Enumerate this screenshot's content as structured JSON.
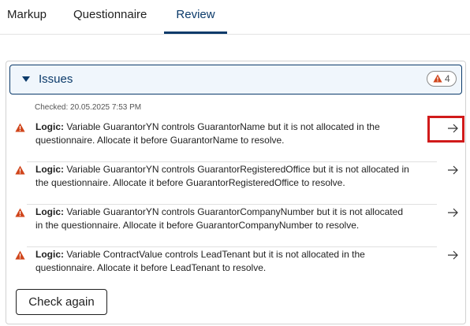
{
  "tabs": {
    "markup": "Markup",
    "questionnaire": "Questionnaire",
    "review": "Review"
  },
  "issues": {
    "title": "Issues",
    "count": "4",
    "checked": "Checked: 20.05.2025 7:53 PM",
    "items": [
      {
        "label": "Logic:",
        "text_line1": " Variable GuarantorYN controls GuarantorName but it is not allocated in the",
        "text_line2": "questionnaire. Allocate it before GuarantorName to resolve."
      },
      {
        "label": "Logic:",
        "text_line1": " Variable GuarantorYN controls GuarantorRegisteredOffice but it is not allocated in",
        "text_line2": "the questionnaire. Allocate it before GuarantorRegisteredOffice to resolve."
      },
      {
        "label": "Logic:",
        "text_line1": " Variable GuarantorYN controls GuarantorCompanyNumber but it is not allocated",
        "text_line2": "in the questionnaire. Allocate it before GuarantorCompanyNumber to resolve."
      },
      {
        "label": "Logic:",
        "text_line1": " Variable ContractValue controls LeadTenant but it is not allocated in the",
        "text_line2": "questionnaire. Allocate it before LeadTenant to resolve."
      }
    ]
  },
  "actions": {
    "check_again": "Check again"
  },
  "icons": {
    "warning": "warning-icon",
    "arrow": "arrow-right-icon",
    "caret": "caret-down-icon"
  },
  "colors": {
    "accent": "#0b3a6a",
    "warning": "#d0451b",
    "highlight": "#d11b1b"
  }
}
